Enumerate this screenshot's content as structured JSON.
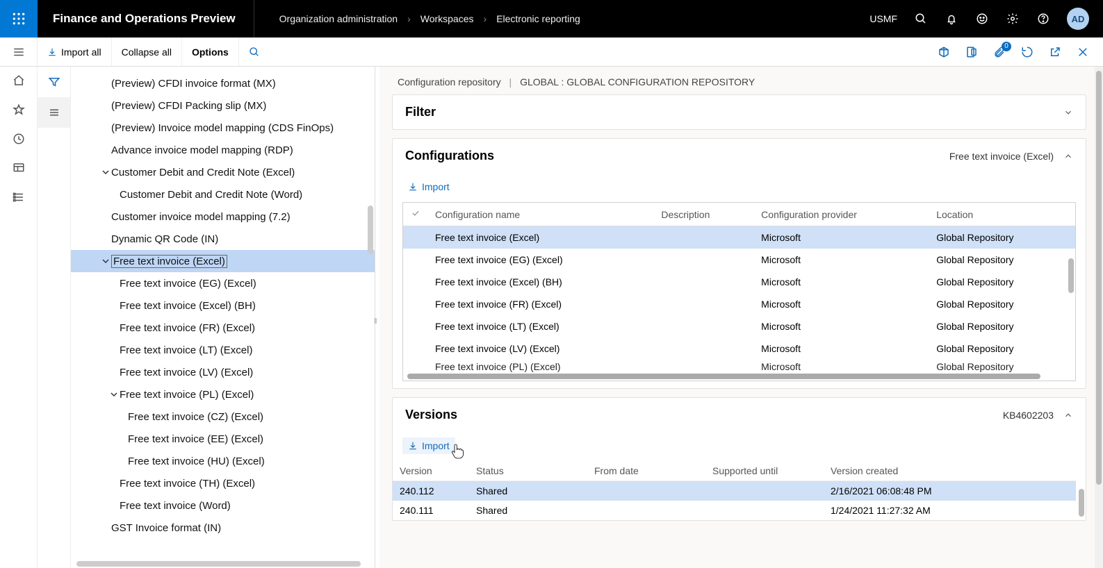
{
  "app_title": "Finance and Operations Preview",
  "breadcrumb": [
    "Organization administration",
    "Workspaces",
    "Electronic reporting"
  ],
  "company": "USMF",
  "avatar_initials": "AD",
  "actions": {
    "import_all": "Import all",
    "collapse_all": "Collapse all",
    "options": "Options",
    "attachment_badge": "0"
  },
  "tree": [
    {
      "label": "(Preview) CFDI invoice format (MX)",
      "indent": 42,
      "caret": ""
    },
    {
      "label": "(Preview) CFDI Packing slip (MX)",
      "indent": 42,
      "caret": ""
    },
    {
      "label": "(Preview) Invoice model mapping (CDS FinOps)",
      "indent": 42,
      "caret": ""
    },
    {
      "label": "Advance invoice model mapping (RDP)",
      "indent": 42,
      "caret": ""
    },
    {
      "label": "Customer Debit and Credit Note (Excel)",
      "indent": 42,
      "caret": "down"
    },
    {
      "label": "Customer Debit and Credit Note (Word)",
      "indent": 54,
      "caret": ""
    },
    {
      "label": "Customer invoice model mapping (7.2)",
      "indent": 42,
      "caret": ""
    },
    {
      "label": "Dynamic QR Code (IN)",
      "indent": 42,
      "caret": ""
    },
    {
      "label": "Free text invoice (Excel)",
      "indent": 42,
      "caret": "down",
      "selected": true
    },
    {
      "label": "Free text invoice (EG) (Excel)",
      "indent": 54,
      "caret": ""
    },
    {
      "label": "Free text invoice (Excel) (BH)",
      "indent": 54,
      "caret": ""
    },
    {
      "label": "Free text invoice (FR) (Excel)",
      "indent": 54,
      "caret": ""
    },
    {
      "label": "Free text invoice (LT) (Excel)",
      "indent": 54,
      "caret": ""
    },
    {
      "label": "Free text invoice (LV) (Excel)",
      "indent": 54,
      "caret": ""
    },
    {
      "label": "Free text invoice (PL) (Excel)",
      "indent": 54,
      "caret": "down"
    },
    {
      "label": "Free text invoice (CZ) (Excel)",
      "indent": 66,
      "caret": ""
    },
    {
      "label": "Free text invoice (EE) (Excel)",
      "indent": 66,
      "caret": ""
    },
    {
      "label": "Free text invoice (HU) (Excel)",
      "indent": 66,
      "caret": ""
    },
    {
      "label": "Free text invoice (TH) (Excel)",
      "indent": 54,
      "caret": ""
    },
    {
      "label": "Free text invoice (Word)",
      "indent": 54,
      "caret": ""
    },
    {
      "label": "GST Invoice format (IN)",
      "indent": 42,
      "caret": ""
    }
  ],
  "repo_path": {
    "left": "Configuration repository",
    "right": "GLOBAL : GLOBAL CONFIGURATION REPOSITORY"
  },
  "filter_title": "Filter",
  "configs": {
    "title": "Configurations",
    "selected_hint": "Free text invoice (Excel)",
    "import_label": "Import",
    "columns": [
      "Configuration name",
      "Description",
      "Configuration provider",
      "Location"
    ],
    "rows": [
      {
        "name": "Free text invoice (Excel)",
        "desc": "",
        "provider": "Microsoft",
        "loc": "Global Repository",
        "selected": true
      },
      {
        "name": "Free text invoice (EG) (Excel)",
        "desc": "",
        "provider": "Microsoft",
        "loc": "Global Repository"
      },
      {
        "name": "Free text invoice (Excel) (BH)",
        "desc": "",
        "provider": "Microsoft",
        "loc": "Global Repository"
      },
      {
        "name": "Free text invoice (FR) (Excel)",
        "desc": "",
        "provider": "Microsoft",
        "loc": "Global Repository"
      },
      {
        "name": "Free text invoice (LT) (Excel)",
        "desc": "",
        "provider": "Microsoft",
        "loc": "Global Repository"
      },
      {
        "name": "Free text invoice (LV) (Excel)",
        "desc": "",
        "provider": "Microsoft",
        "loc": "Global Repository"
      },
      {
        "name": "Free text invoice (PL) (Excel)",
        "desc": "",
        "provider": "Microsoft",
        "loc": "Global Repository",
        "partial": true
      }
    ]
  },
  "versions": {
    "title": "Versions",
    "kb_hint": "KB4602203",
    "import_label": "Import",
    "columns": [
      "Version",
      "Status",
      "From date",
      "Supported until",
      "Version created"
    ],
    "rows": [
      {
        "ver": "240.112",
        "status": "Shared",
        "from": "",
        "until": "",
        "created": "2/16/2021 06:08:48 PM",
        "selected": true
      },
      {
        "ver": "240.111",
        "status": "Shared",
        "from": "",
        "until": "",
        "created": "1/24/2021 11:27:32 AM"
      }
    ]
  }
}
